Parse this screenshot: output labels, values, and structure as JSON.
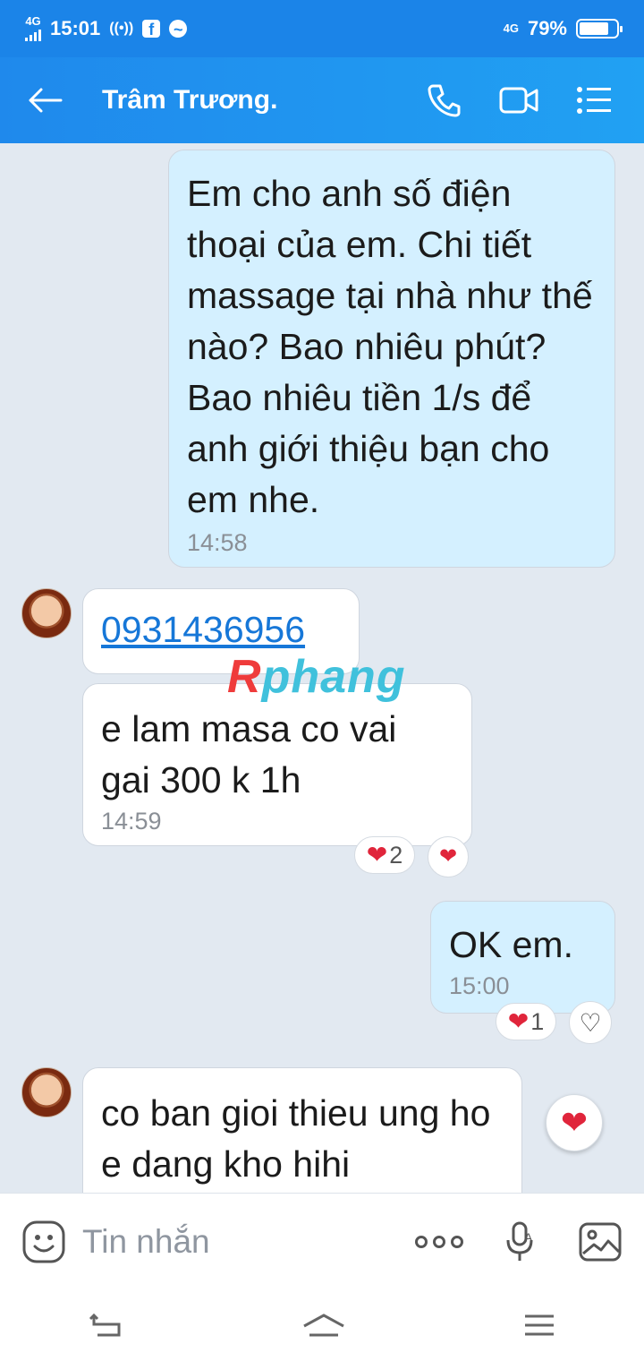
{
  "status_bar": {
    "network": "4G",
    "time": "15:01",
    "network_right": "4G",
    "battery": "79%",
    "battery_level": 0.79
  },
  "header": {
    "contact_name": "Trâm Trương."
  },
  "messages": [
    {
      "direction": "out",
      "text": "Em cho anh số điện thoại của em. Chi tiết massage tại nhà như thế nào? Bao nhiêu phút? Bao nhiêu tiền 1/s để anh giới thiệu bạn cho em nhe.",
      "time": "14:58"
    },
    {
      "direction": "in",
      "link": "0931436956"
    },
    {
      "direction": "in",
      "text": "e lam masa co vai gai 300 k 1h",
      "time": "14:59",
      "reaction_count": "2"
    },
    {
      "direction": "out",
      "text": "OK em.",
      "time": "15:00",
      "reaction_count": "1"
    },
    {
      "direction": "in",
      "text": "co ban gioi thieu ung ho e dang kho hihi"
    }
  ],
  "watermark": {
    "first_letter": "R",
    "rest": "phang"
  },
  "composer": {
    "placeholder": "Tin nhắn"
  },
  "colors": {
    "header": "#1f89ec",
    "outgoing_bubble": "#d4f0ff",
    "incoming_bubble": "#ffffff",
    "heart": "#e0253b",
    "link": "#1677d8"
  }
}
